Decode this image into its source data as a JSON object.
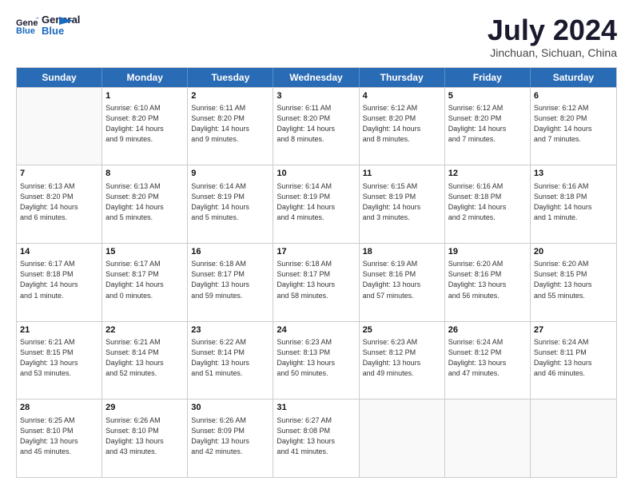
{
  "logo": {
    "line1": "General",
    "line2": "Blue"
  },
  "title": "July 2024",
  "subtitle": "Jinchuan, Sichuan, China",
  "header_days": [
    "Sunday",
    "Monday",
    "Tuesday",
    "Wednesday",
    "Thursday",
    "Friday",
    "Saturday"
  ],
  "weeks": [
    [
      {
        "day": "",
        "info": ""
      },
      {
        "day": "1",
        "info": "Sunrise: 6:10 AM\nSunset: 8:20 PM\nDaylight: 14 hours\nand 9 minutes."
      },
      {
        "day": "2",
        "info": "Sunrise: 6:11 AM\nSunset: 8:20 PM\nDaylight: 14 hours\nand 9 minutes."
      },
      {
        "day": "3",
        "info": "Sunrise: 6:11 AM\nSunset: 8:20 PM\nDaylight: 14 hours\nand 8 minutes."
      },
      {
        "day": "4",
        "info": "Sunrise: 6:12 AM\nSunset: 8:20 PM\nDaylight: 14 hours\nand 8 minutes."
      },
      {
        "day": "5",
        "info": "Sunrise: 6:12 AM\nSunset: 8:20 PM\nDaylight: 14 hours\nand 7 minutes."
      },
      {
        "day": "6",
        "info": "Sunrise: 6:12 AM\nSunset: 8:20 PM\nDaylight: 14 hours\nand 7 minutes."
      }
    ],
    [
      {
        "day": "7",
        "info": "Sunrise: 6:13 AM\nSunset: 8:20 PM\nDaylight: 14 hours\nand 6 minutes."
      },
      {
        "day": "8",
        "info": "Sunrise: 6:13 AM\nSunset: 8:20 PM\nDaylight: 14 hours\nand 5 minutes."
      },
      {
        "day": "9",
        "info": "Sunrise: 6:14 AM\nSunset: 8:19 PM\nDaylight: 14 hours\nand 5 minutes."
      },
      {
        "day": "10",
        "info": "Sunrise: 6:14 AM\nSunset: 8:19 PM\nDaylight: 14 hours\nand 4 minutes."
      },
      {
        "day": "11",
        "info": "Sunrise: 6:15 AM\nSunset: 8:19 PM\nDaylight: 14 hours\nand 3 minutes."
      },
      {
        "day": "12",
        "info": "Sunrise: 6:16 AM\nSunset: 8:18 PM\nDaylight: 14 hours\nand 2 minutes."
      },
      {
        "day": "13",
        "info": "Sunrise: 6:16 AM\nSunset: 8:18 PM\nDaylight: 14 hours\nand 1 minute."
      }
    ],
    [
      {
        "day": "14",
        "info": "Sunrise: 6:17 AM\nSunset: 8:18 PM\nDaylight: 14 hours\nand 1 minute."
      },
      {
        "day": "15",
        "info": "Sunrise: 6:17 AM\nSunset: 8:17 PM\nDaylight: 14 hours\nand 0 minutes."
      },
      {
        "day": "16",
        "info": "Sunrise: 6:18 AM\nSunset: 8:17 PM\nDaylight: 13 hours\nand 59 minutes."
      },
      {
        "day": "17",
        "info": "Sunrise: 6:18 AM\nSunset: 8:17 PM\nDaylight: 13 hours\nand 58 minutes."
      },
      {
        "day": "18",
        "info": "Sunrise: 6:19 AM\nSunset: 8:16 PM\nDaylight: 13 hours\nand 57 minutes."
      },
      {
        "day": "19",
        "info": "Sunrise: 6:20 AM\nSunset: 8:16 PM\nDaylight: 13 hours\nand 56 minutes."
      },
      {
        "day": "20",
        "info": "Sunrise: 6:20 AM\nSunset: 8:15 PM\nDaylight: 13 hours\nand 55 minutes."
      }
    ],
    [
      {
        "day": "21",
        "info": "Sunrise: 6:21 AM\nSunset: 8:15 PM\nDaylight: 13 hours\nand 53 minutes."
      },
      {
        "day": "22",
        "info": "Sunrise: 6:21 AM\nSunset: 8:14 PM\nDaylight: 13 hours\nand 52 minutes."
      },
      {
        "day": "23",
        "info": "Sunrise: 6:22 AM\nSunset: 8:14 PM\nDaylight: 13 hours\nand 51 minutes."
      },
      {
        "day": "24",
        "info": "Sunrise: 6:23 AM\nSunset: 8:13 PM\nDaylight: 13 hours\nand 50 minutes."
      },
      {
        "day": "25",
        "info": "Sunrise: 6:23 AM\nSunset: 8:12 PM\nDaylight: 13 hours\nand 49 minutes."
      },
      {
        "day": "26",
        "info": "Sunrise: 6:24 AM\nSunset: 8:12 PM\nDaylight: 13 hours\nand 47 minutes."
      },
      {
        "day": "27",
        "info": "Sunrise: 6:24 AM\nSunset: 8:11 PM\nDaylight: 13 hours\nand 46 minutes."
      }
    ],
    [
      {
        "day": "28",
        "info": "Sunrise: 6:25 AM\nSunset: 8:10 PM\nDaylight: 13 hours\nand 45 minutes."
      },
      {
        "day": "29",
        "info": "Sunrise: 6:26 AM\nSunset: 8:10 PM\nDaylight: 13 hours\nand 43 minutes."
      },
      {
        "day": "30",
        "info": "Sunrise: 6:26 AM\nSunset: 8:09 PM\nDaylight: 13 hours\nand 42 minutes."
      },
      {
        "day": "31",
        "info": "Sunrise: 6:27 AM\nSunset: 8:08 PM\nDaylight: 13 hours\nand 41 minutes."
      },
      {
        "day": "",
        "info": ""
      },
      {
        "day": "",
        "info": ""
      },
      {
        "day": "",
        "info": ""
      }
    ]
  ]
}
